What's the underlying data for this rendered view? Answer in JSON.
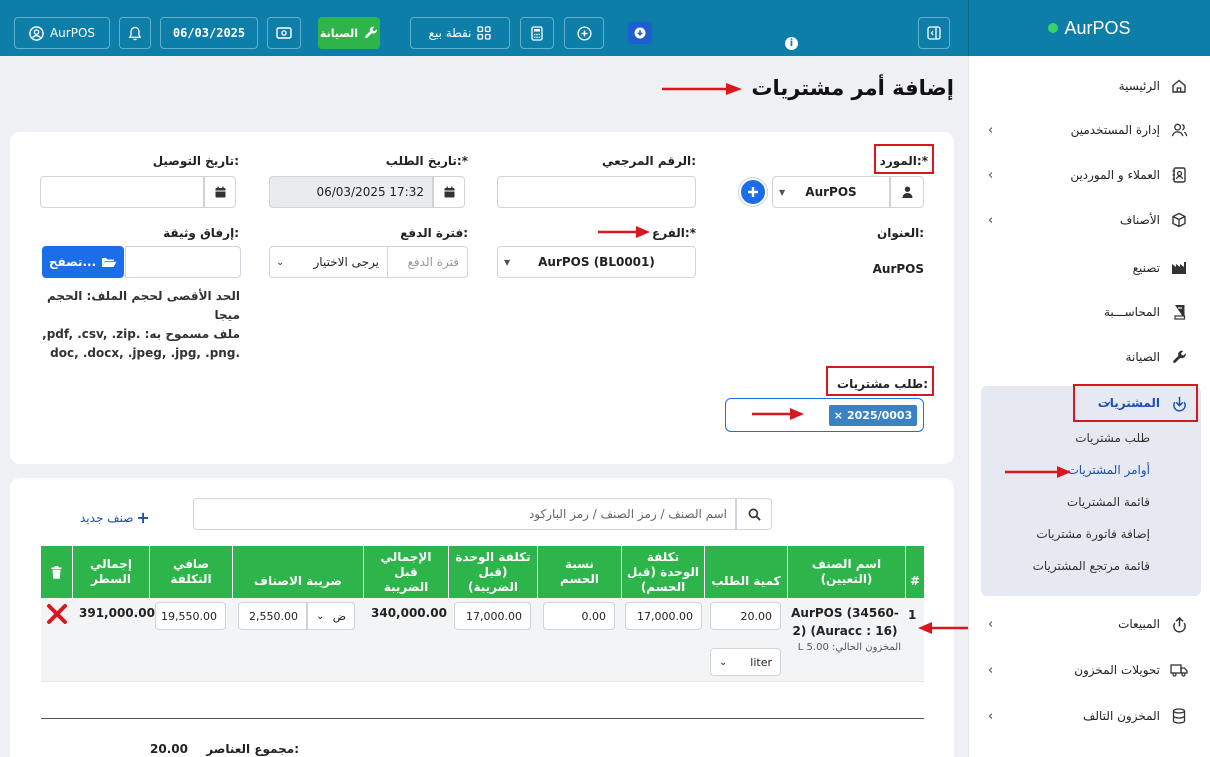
{
  "topbar": {
    "user": "AurPOS",
    "date": "06/03/2025",
    "maintenance": "الصيانة",
    "pos": "نقطة بيع"
  },
  "brand": "AurPOS",
  "sidebar": {
    "items": [
      {
        "label": "الرئيسية",
        "icon": "home-icon"
      },
      {
        "label": "إدارة المستخدمين",
        "icon": "users-icon"
      },
      {
        "label": "العملاء و الموردين",
        "icon": "address-book-icon"
      },
      {
        "label": "الأصناف",
        "icon": "box-icon"
      },
      {
        "label": "تصنيع",
        "icon": "industry-icon"
      },
      {
        "label": "المحاســـبة",
        "icon": "book-icon"
      },
      {
        "label": "الصيانة",
        "icon": "wrench-icon"
      },
      {
        "label": "المشتريات",
        "icon": "download-icon"
      },
      {
        "label": "المبيعات",
        "icon": "upload-icon"
      },
      {
        "label": "تحويلات المخزون",
        "icon": "truck-icon"
      },
      {
        "label": "المخزون التالف",
        "icon": "database-icon"
      }
    ],
    "purchases_sub": [
      "طلب مشتريات",
      "أوامر المشتريات",
      "قائمة المشتريات",
      "إضافة فاتورة مشتريات",
      "قائمة مرتجع المشتريات"
    ]
  },
  "page": {
    "title": "إضافة أمر مشتريات"
  },
  "form": {
    "supplier_label": "المورد:*",
    "supplier_value": "AurPOS",
    "ref_label": "الرقم المرجعي:",
    "order_date_label": "تاريخ الطلب:*",
    "order_date_value": "06/03/2025 17:32",
    "delivery_date_label": "تاريخ التوصيل:",
    "address_label": "العنوان:",
    "address_value": "AurPOS",
    "branch_label": "الفرع:*",
    "branch_value": "AurPOS (BL0001)",
    "pay_term_label": "فترة الدفع:",
    "pay_term_placeholder": "فترة الدفع",
    "pay_term_select": "يرجى الاختيار",
    "attach_label": "إرفاق وثيقة:",
    "browse_label": "تصفح...",
    "file_note_1": "الحد الأقصى لحجم الملف: الحجم",
    "file_note_2": "ميجا",
    "file_note_3": "ملف مسموح به: .pdf, .csv, .zip,",
    "file_note_4": ".doc, .docx, .jpeg, .jpg, .png",
    "pr_label": "طلب مشتريات:",
    "pr_tag": "2025/0003",
    "pr_tag_x": "×"
  },
  "search": {
    "placeholder": "اسم الصنف / رمز الصنف / رمز الباركود",
    "new_item": "صنف جديد"
  },
  "table": {
    "headers": [
      "#",
      "اسم الصنف (التعيين)",
      "كمية الطلب",
      "تكلفة الوحدة (قبل الحسم)",
      "نسبة الحسم",
      "تكلفة الوحدة (قبل الضريبة)",
      "الإجمالي قبل الضريبة",
      "ضريبة الاصناف",
      "صافي التكلفة",
      "إجمالي السطر"
    ],
    "row": {
      "num": "1",
      "name": "AurPOS (34560-2) (Auracc : 16)",
      "stock": "المخزون الحالي: L 5.00",
      "qty": "20.00",
      "unit": "liter",
      "unit_cost": "17,000.00",
      "discount": "0.00",
      "cost_before_tax": "17,000.00",
      "total_before_tax": "340,000.00",
      "tax_select": "ض",
      "tax_value": "2,550.00",
      "net_cost": "19,550.00",
      "line_total": "391,000.00"
    }
  },
  "totals": {
    "items_label": "مجموع العناصر:",
    "items_value": "20.00"
  },
  "colors": {
    "topbar": "#0d7ea7",
    "table_header": "#2db54b",
    "annotation": "#d7191f",
    "primary": "#1b6ee8"
  }
}
